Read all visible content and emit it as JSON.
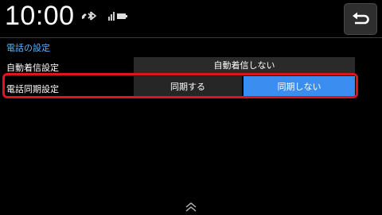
{
  "status": {
    "time": "10:00",
    "icons": [
      "bluetooth-phone-icon",
      "signal-battery-icon"
    ]
  },
  "navigation": {
    "back_icon": "return-arrow-icon",
    "scroll_icon": "double-chevron-up-icon"
  },
  "section": {
    "title": "電話の設定"
  },
  "settings": [
    {
      "label": "自動着信設定",
      "value": "自動着信しない"
    },
    {
      "label": "電話同期設定",
      "options": [
        "同期する",
        "同期しない"
      ],
      "selected": "同期しない"
    }
  ],
  "colors": {
    "accent": "#3a8ef0",
    "section_title": "#58b2ff",
    "highlight_border": "#e0141b"
  }
}
